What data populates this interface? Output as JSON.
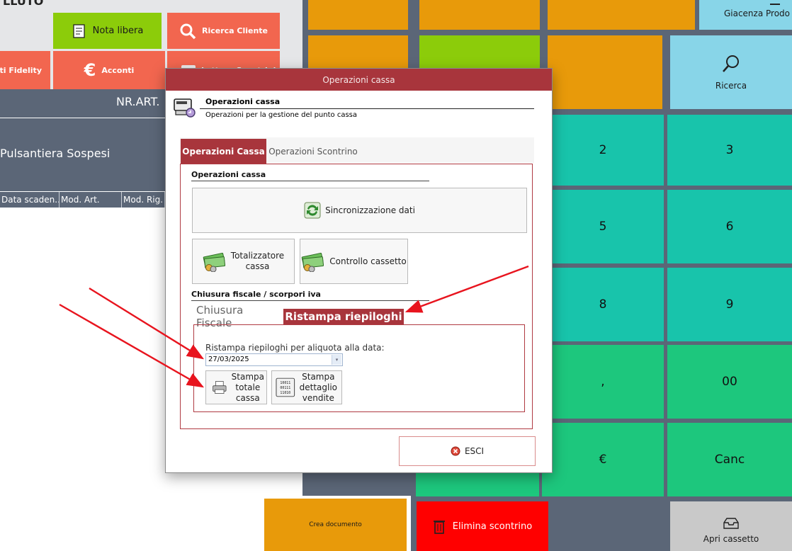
{
  "top_left": {
    "partial_title": "LLUTO",
    "nota_libera": "Nota libera",
    "ricerca_cliente": "Ricerca Cliente",
    "sconti_fidelity": "enti Fidelity",
    "acconti": "Acconti",
    "hidden_button": "Lettura Scontrini"
  },
  "grid": {
    "nr_art_label": "NR.ART.",
    "sospesi_label": "Pulsantiera Sospesi",
    "columns": [
      "Data scaden...",
      "Mod. Art.",
      "Mod. Rig."
    ]
  },
  "right_panel": {
    "giacenza": "Giacenza Prodo",
    "ricerca": "Ricerca",
    "keys": [
      "2",
      "3",
      "5",
      "6",
      "8",
      "9",
      ",",
      "00",
      "€",
      "Canc"
    ],
    "crea_documento": "Crea documento",
    "elimina_scontrino": "Elimina scontrino",
    "apri_cassetto": "Apri cassetto"
  },
  "modal": {
    "window_title": "Operazioni cassa",
    "header_title": "Operazioni cassa",
    "header_subtitle": "Operazioni per la gestione del punto cassa",
    "tabs": [
      "Operazioni Cassa",
      "Operazioni Scontrino"
    ],
    "section_cassa": "Operazioni cassa",
    "sync_button": "Sincronizzazione dati",
    "totalizzatore_line1": "Totalizzatore",
    "totalizzatore_line2": "cassa",
    "controllo_cassetto": "Controllo cassetto",
    "section_fiscale": "Chiusura fiscale / scorpori iva",
    "subtabs": [
      "Chiusura Fiscale",
      "Ristampa riepiloghi"
    ],
    "ristampa_label": "Ristampa riepiloghi per aliquota alla data:",
    "date_value": "27/03/2025",
    "stampa_totale": [
      "Stampa",
      "totale",
      "cassa"
    ],
    "stampa_dettaglio": [
      "Stampa",
      "dettaglio",
      "vendite"
    ],
    "esci": "ESCI"
  },
  "colors": {
    "orange": "#e89a0a",
    "lime": "#8ccc0a",
    "teal": "#18c4ab",
    "green": "#1dc77d",
    "light_blue": "#88d5e8",
    "salmon": "#f2664f",
    "slate": "#5b6677",
    "modal_red": "#a8353c",
    "arrow_red": "#e8141e"
  }
}
